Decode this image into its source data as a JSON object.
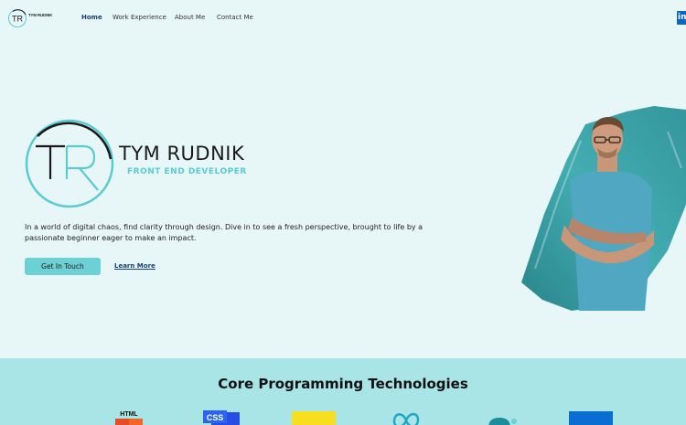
{
  "nav": {
    "logo_monogram": "TR",
    "logo_name": "TYM RUDNIK",
    "links": [
      {
        "label": "Home",
        "active": true
      },
      {
        "label": "Work Experience",
        "active": false
      },
      {
        "label": "About Me",
        "active": false
      },
      {
        "label": "Contact Me",
        "active": false
      }
    ],
    "social_icon": "linkedin-icon",
    "social_label": "in"
  },
  "hero": {
    "monogram": "TR",
    "name": "TYM RUDNIK",
    "role": "FRONT END DEVELOPER",
    "tagline": "In a world of digital chaos, find clarity through design. Dive in to see a fresh perspective, brought to life by a passionate beginner eager to make an impact.",
    "primary_button": "Get In Touch",
    "secondary_link": "Learn More"
  },
  "tech": {
    "title": "Core Programming Technologies",
    "icons": [
      {
        "name": "html5-icon",
        "label": "HTML"
      },
      {
        "name": "css3-icon",
        "label": "CSS"
      },
      {
        "name": "javascript-icon",
        "label": ""
      },
      {
        "name": "meta-icon",
        "label": ""
      },
      {
        "name": "tech-icon-5",
        "label": ""
      },
      {
        "name": "tech-icon-6",
        "label": ""
      }
    ]
  },
  "colors": {
    "background": "#e7f6f7",
    "accent": "#5ccad1",
    "button": "#6dd0d4",
    "nav_active": "#15407a",
    "section_bg": "#a9e4e6"
  }
}
